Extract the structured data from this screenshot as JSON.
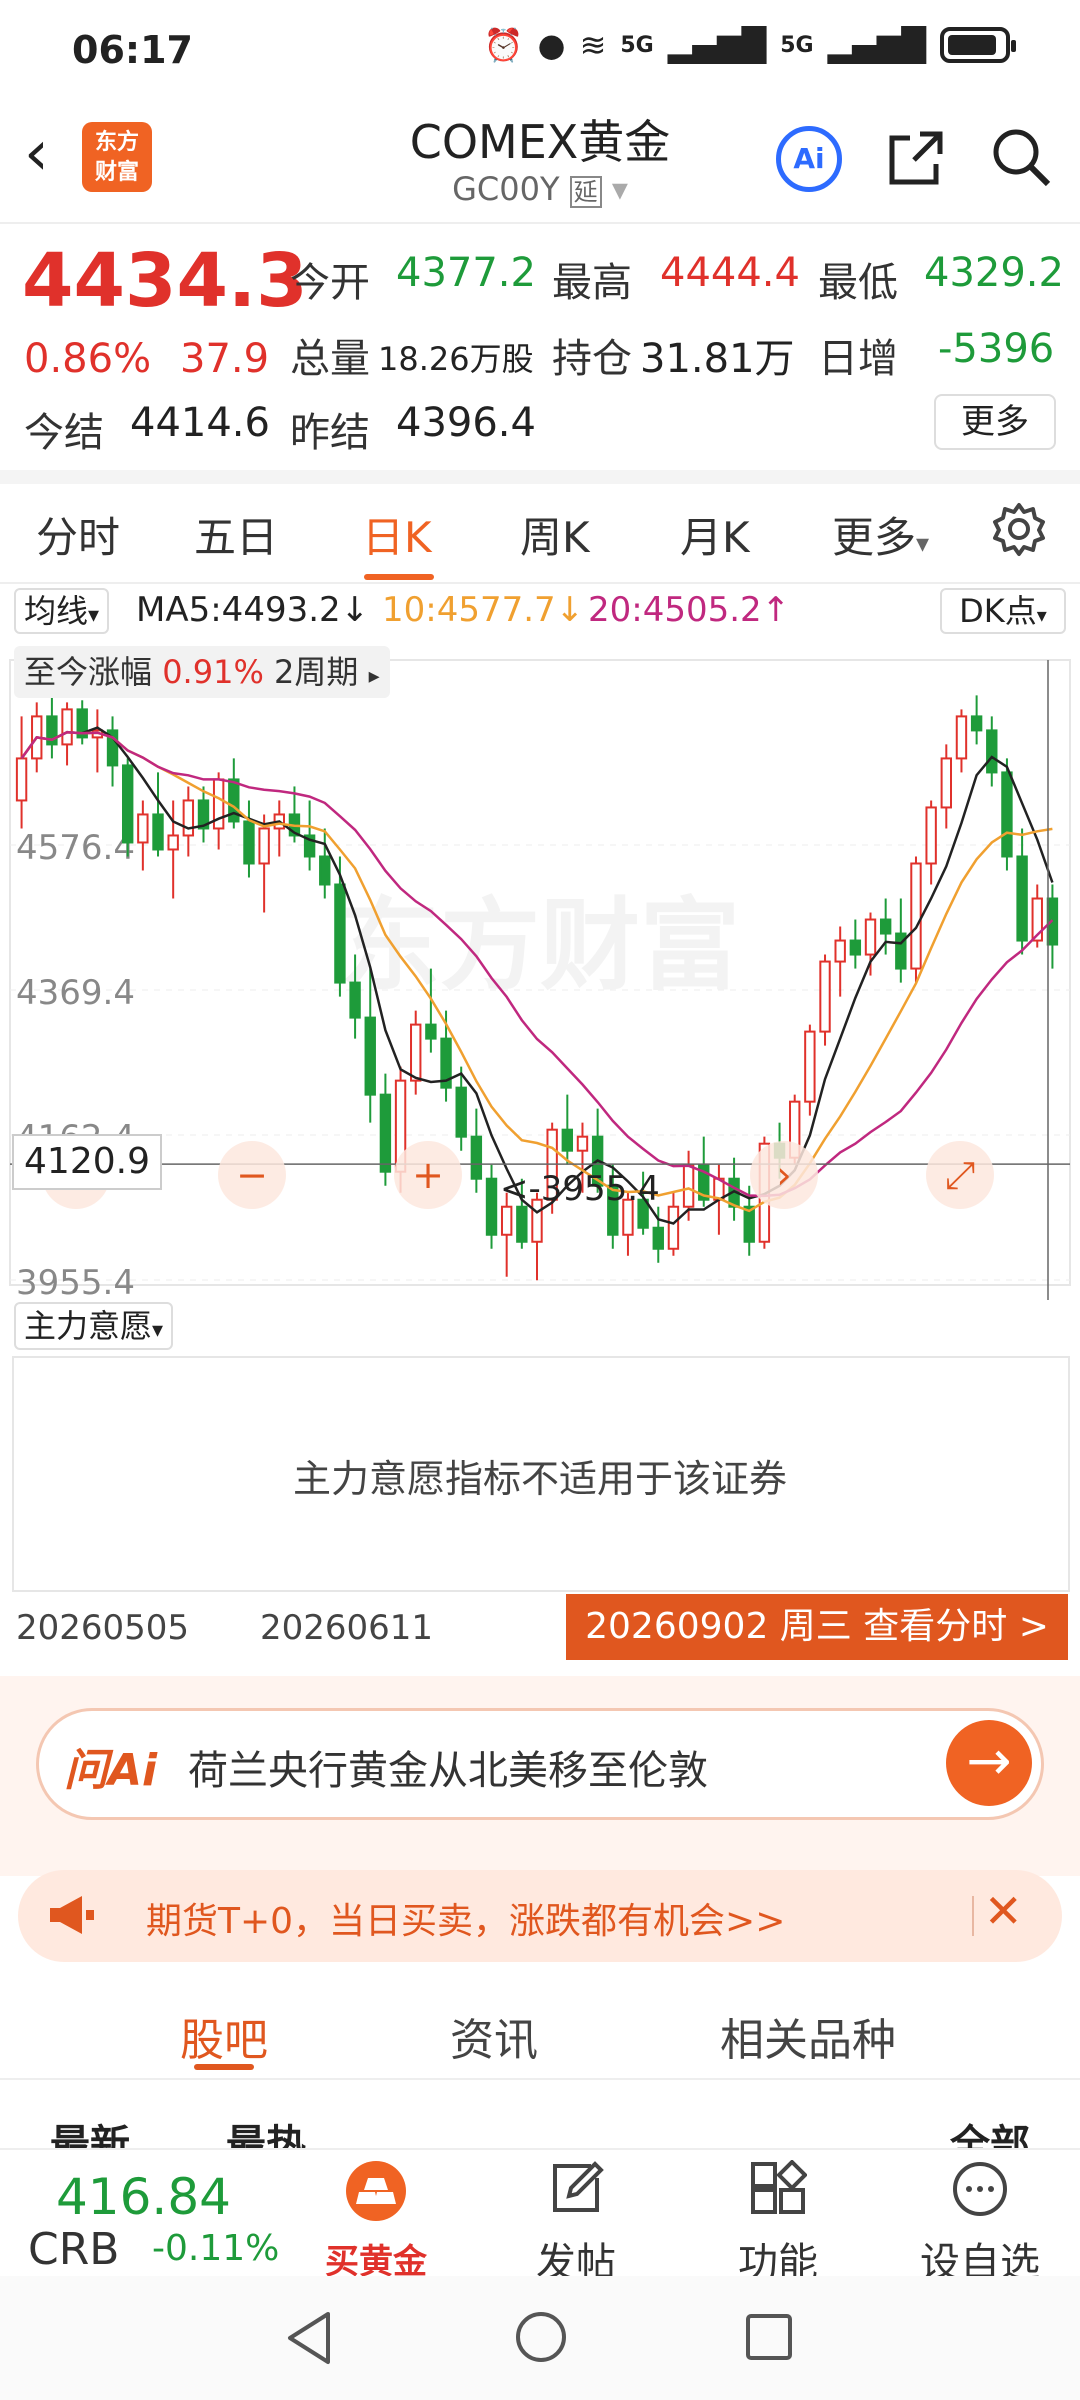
{
  "status_bar": {
    "time": "06:17",
    "net1": "5G",
    "net2": "5G"
  },
  "header": {
    "logo_text": "东方财富",
    "title": "COMEX黄金",
    "subtitle": "GC00Y",
    "subtitle_badge": "延",
    "ai_label": "Ai"
  },
  "quote": {
    "price": "4434.3",
    "change_pct": "0.86%",
    "change_amt": "37.9",
    "open_label": "今开",
    "open": "4377.2",
    "high_label": "最高",
    "high": "4444.4",
    "low_label": "最低",
    "low": "4329.2",
    "volume_label": "总量",
    "volume": "18.26万股",
    "oi_label": "持仓",
    "oi": "31.81万",
    "daily_inc_label": "日增",
    "daily_inc": "-5396",
    "settle_label": "今结",
    "settle": "4414.6",
    "prev_settle_label": "昨结",
    "prev_settle": "4396.4",
    "more_label": "更多"
  },
  "period_tabs": [
    "分时",
    "五日",
    "日K",
    "周K",
    "月K",
    "更多"
  ],
  "period_active": "日K",
  "ma": {
    "selector": "均线",
    "ma5": "MA5:4493.2↓",
    "ma10": "10:4577.7↓",
    "ma20": "20:4505.2↑",
    "dk_label": "DK点",
    "colors": {
      "ma5": "#222222",
      "ma10": "#f0a030",
      "ma20": "#c0287f"
    }
  },
  "chart": {
    "range_label": "至今涨幅",
    "range_pct": "0.91%",
    "range_period": "2周期",
    "watermark": "东方财富",
    "crosshair_price": "4120.9",
    "min_marker": "<-3955.4",
    "y_ticks": [
      "4576.4",
      "4369.4",
      "4162.4",
      "3955.4"
    ]
  },
  "chart_data": {
    "type": "candlestick",
    "ylim": [
      3955.4,
      4783.4
    ],
    "y_ticks": [
      4576.4,
      4369.4,
      4162.4,
      3955.4
    ],
    "x_labels": [
      "20260505",
      "20260611"
    ],
    "candles": [
      [
        4640,
        4760,
        4600,
        4700
      ],
      [
        4700,
        4780,
        4680,
        4760
      ],
      [
        4760,
        4790,
        4700,
        4720
      ],
      [
        4720,
        4780,
        4690,
        4770
      ],
      [
        4770,
        4783,
        4720,
        4730
      ],
      [
        4730,
        4770,
        4680,
        4740
      ],
      [
        4740,
        4760,
        4660,
        4690
      ],
      [
        4690,
        4700,
        4560,
        4580
      ],
      [
        4580,
        4640,
        4540,
        4620
      ],
      [
        4620,
        4680,
        4560,
        4570
      ],
      [
        4570,
        4640,
        4500,
        4590
      ],
      [
        4590,
        4660,
        4560,
        4640
      ],
      [
        4640,
        4660,
        4580,
        4600
      ],
      [
        4600,
        4680,
        4570,
        4670
      ],
      [
        4670,
        4700,
        4600,
        4610
      ],
      [
        4610,
        4640,
        4530,
        4550
      ],
      [
        4550,
        4620,
        4480,
        4600
      ],
      [
        4600,
        4640,
        4560,
        4620
      ],
      [
        4620,
        4660,
        4580,
        4590
      ],
      [
        4590,
        4640,
        4540,
        4560
      ],
      [
        4560,
        4600,
        4500,
        4520
      ],
      [
        4520,
        4560,
        4360,
        4380
      ],
      [
        4380,
        4420,
        4300,
        4330
      ],
      [
        4330,
        4400,
        4180,
        4220
      ],
      [
        4220,
        4250,
        4090,
        4110
      ],
      [
        4110,
        4260,
        4080,
        4240
      ],
      [
        4240,
        4340,
        4220,
        4320
      ],
      [
        4320,
        4400,
        4280,
        4300
      ],
      [
        4300,
        4340,
        4210,
        4230
      ],
      [
        4230,
        4260,
        4140,
        4160
      ],
      [
        4160,
        4200,
        4080,
        4100
      ],
      [
        4100,
        4120,
        4000,
        4020
      ],
      [
        4020,
        4080,
        3960,
        4060
      ],
      [
        4060,
        4100,
        4000,
        4010
      ],
      [
        4010,
        4080,
        3955,
        4070
      ],
      [
        4070,
        4180,
        4050,
        4170
      ],
      [
        4170,
        4220,
        4120,
        4140
      ],
      [
        4140,
        4180,
        4080,
        4160
      ],
      [
        4160,
        4200,
        4080,
        4090
      ],
      [
        4090,
        4120,
        4000,
        4020
      ],
      [
        4020,
        4080,
        3990,
        4070
      ],
      [
        4070,
        4110,
        4020,
        4030
      ],
      [
        4030,
        4060,
        3980,
        4000
      ],
      [
        4000,
        4080,
        3990,
        4060
      ],
      [
        4060,
        4140,
        4040,
        4120
      ],
      [
        4120,
        4160,
        4060,
        4070
      ],
      [
        4070,
        4120,
        4020,
        4100
      ],
      [
        4100,
        4130,
        4040,
        4060
      ],
      [
        4060,
        4090,
        3990,
        4010
      ],
      [
        4010,
        4160,
        4000,
        4150
      ],
      [
        4150,
        4180,
        4100,
        4130
      ],
      [
        4130,
        4220,
        4120,
        4210
      ],
      [
        4210,
        4320,
        4190,
        4310
      ],
      [
        4310,
        4420,
        4290,
        4410
      ],
      [
        4410,
        4460,
        4360,
        4440
      ],
      [
        4440,
        4470,
        4400,
        4420
      ],
      [
        4420,
        4480,
        4390,
        4470
      ],
      [
        4470,
        4500,
        4420,
        4450
      ],
      [
        4450,
        4500,
        4380,
        4400
      ],
      [
        4400,
        4560,
        4380,
        4550
      ],
      [
        4550,
        4640,
        4520,
        4630
      ],
      [
        4630,
        4720,
        4600,
        4700
      ],
      [
        4700,
        4770,
        4680,
        4760
      ],
      [
        4760,
        4790,
        4720,
        4740
      ],
      [
        4740,
        4760,
        4660,
        4680
      ],
      [
        4680,
        4700,
        4540,
        4560
      ],
      [
        4560,
        4600,
        4420,
        4440
      ],
      [
        4440,
        4520,
        4430,
        4500
      ],
      [
        4500,
        4520,
        4400,
        4434.3
      ]
    ],
    "series": [
      {
        "name": "MA5",
        "color": "#222222"
      },
      {
        "name": "MA10",
        "color": "#f0a030"
      },
      {
        "name": "MA20",
        "color": "#c0287f"
      }
    ],
    "up_color": "#e0312b",
    "down_color": "#1e9b3a"
  },
  "indicator": {
    "selector": "主力意愿",
    "message": "主力意愿指标不适用于该证券"
  },
  "dates": {
    "left": "20260505",
    "mid": "20260611",
    "selected": "20260902 周三 查看分时 >"
  },
  "ask_ai": {
    "logo": "问Ai",
    "text": "荷兰央行黄金从北美移至伦敦"
  },
  "promo": {
    "text": "期货T+0，当日买卖，涨跌都有机会>>"
  },
  "forum_tabs": [
    "股吧",
    "资讯",
    "相关品种"
  ],
  "forum_active": "股吧",
  "forum_sub": {
    "latest": "最新",
    "hot": "最热",
    "all": "全部"
  },
  "bottom": {
    "crb_value": "416.84",
    "crb_name": "CRB",
    "crb_change": "-0.11%",
    "buy_gold": "买黄金",
    "post": "发帖",
    "functions": "功能",
    "add_watch": "设自选"
  }
}
